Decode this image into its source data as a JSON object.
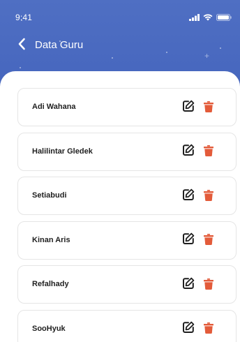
{
  "status_bar": {
    "time": "9:41"
  },
  "header": {
    "title": "Data Guru"
  },
  "teachers": [
    {
      "name": "Adi Wahana"
    },
    {
      "name": "Halilintar Gledek"
    },
    {
      "name": "Setiabudi"
    },
    {
      "name": "Kinan Aris"
    },
    {
      "name": "Refalhady"
    },
    {
      "name": "SooHyuk"
    }
  ],
  "icons": {
    "back": "chevron-left-icon",
    "edit": "edit-icon",
    "delete": "trash-icon",
    "signal": "signal-icon",
    "wifi": "wifi-icon",
    "battery": "battery-icon"
  },
  "colors": {
    "header_bg": "#4a6ac0",
    "delete_icon": "#e35b3a",
    "edit_icon": "#1f1f1f"
  }
}
